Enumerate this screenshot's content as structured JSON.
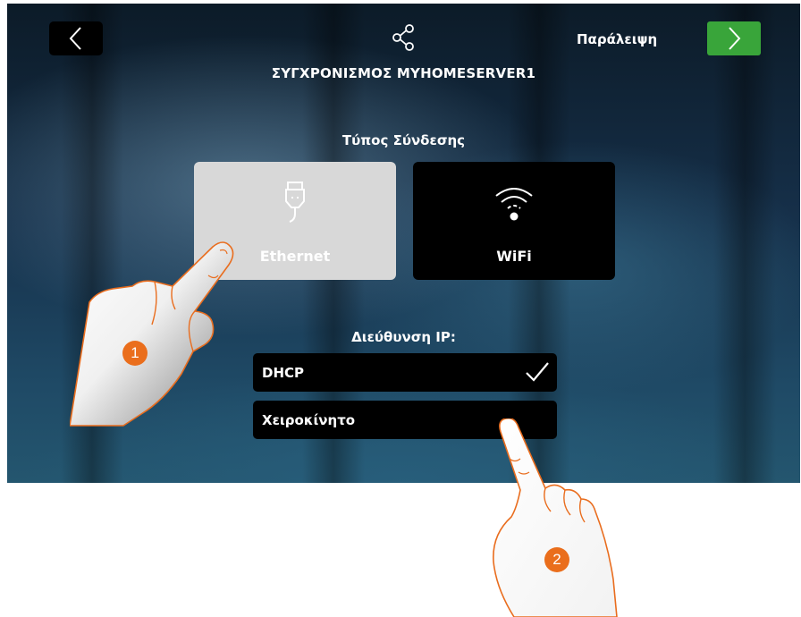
{
  "header": {
    "title": "ΣΥΓΧΡΟΝΙΣΜΟΣ MYHOMESERVER1",
    "skip_label": "Παράλειψη",
    "back_icon": "chevron-left-icon",
    "share_icon": "share-icon",
    "next_icon": "chevron-right-icon"
  },
  "connection": {
    "label": "Τύπος Σύνδεσης",
    "options": [
      {
        "label": "Ethernet",
        "icon": "ethernet-plug-icon",
        "selected": true
      },
      {
        "label": "WiFi",
        "icon": "wifi-icon",
        "selected": false
      }
    ]
  },
  "ip": {
    "label": "Διεύθυνση IP:",
    "options": [
      {
        "label": "DHCP",
        "checked": true,
        "icon": "checkmark-icon"
      },
      {
        "label": "Χειροκίνητο",
        "checked": false
      }
    ]
  },
  "steps": [
    "1",
    "2"
  ],
  "colors": {
    "next_button": "#39a53a",
    "step_badge": "#ea6e1c",
    "selected_card": "#d8d8d8"
  }
}
